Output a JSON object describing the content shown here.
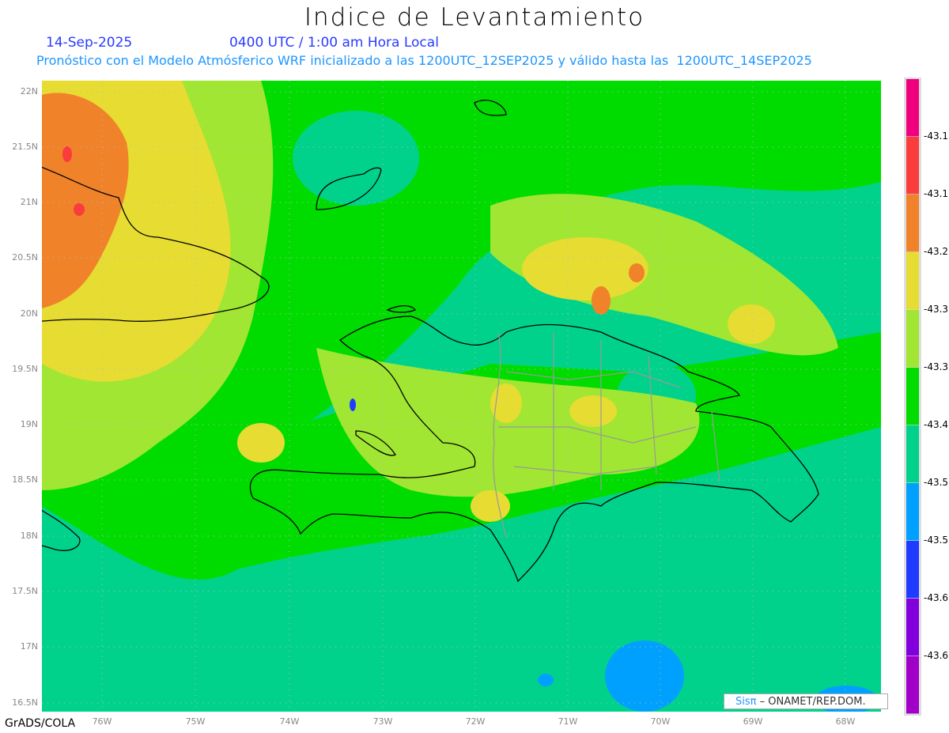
{
  "header": {
    "title": "Indice de Levantamiento",
    "date": "14-Sep-2025",
    "time": "0400 UTC / 1:00 am Hora Local",
    "description": "Pronóstico con el Modelo Atmósferico WRF inicializado a las 1200UTC_12SEP2025 y válido hasta las  1200UTC_14SEP2025"
  },
  "axes": {
    "lat_labels": [
      "22N",
      "21.5N",
      "21N",
      "20.5N",
      "20N",
      "19.5N",
      "19N",
      "18.5N",
      "18N",
      "17.5N",
      "17N",
      "16.5N"
    ],
    "lon_labels": [
      "76W",
      "75W",
      "74W",
      "73W",
      "72W",
      "71W",
      "70W",
      "69W",
      "68W"
    ]
  },
  "colorbar": {
    "labels": [
      "-43.1",
      "-43.1",
      "-43.2",
      "-43.3",
      "-43.3",
      "-43.4",
      "-43.5",
      "-43.5",
      "-43.6",
      "-43.6"
    ],
    "colors": [
      "#f0007f",
      "#fa3c3c",
      "#f0822a",
      "#e6dc32",
      "#a0e632",
      "#00dc00",
      "#00d28c",
      "#00a0ff",
      "#1e3cff",
      "#8200dc",
      "#a000c8"
    ]
  },
  "credit": {
    "logo": "Sisπ",
    "text": " – ONAMET/REP.DOM."
  },
  "footer": "GrADS/COLA"
}
